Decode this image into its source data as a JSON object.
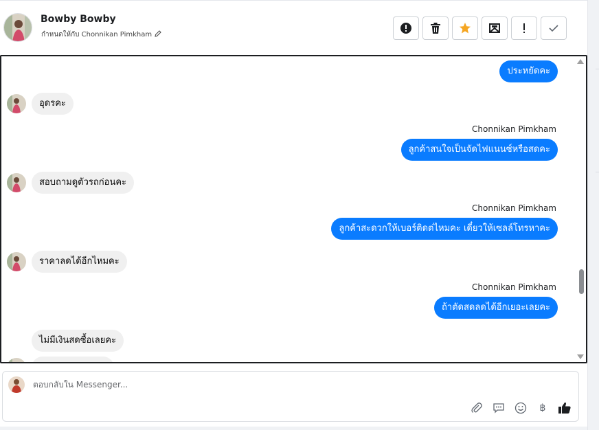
{
  "header": {
    "name": "Bowby Bowby",
    "assigned_text": "กำหนดให้กับ Chonnikan Pimkham",
    "actions": [
      {
        "name": "spam-button",
        "icon": "alert-circle-icon"
      },
      {
        "name": "delete-button",
        "icon": "trash-icon"
      },
      {
        "name": "follow-up-button",
        "icon": "star-icon"
      },
      {
        "name": "mark-unread-button",
        "icon": "envelope-icon"
      },
      {
        "name": "priority-button",
        "icon": "exclamation-icon"
      },
      {
        "name": "done-button",
        "icon": "check-icon"
      }
    ]
  },
  "conversation": {
    "messages": [
      {
        "dir": "out",
        "text": "ประหยัดคะ"
      },
      {
        "dir": "in",
        "text": "อุดรคะ"
      },
      {
        "dir": "out",
        "sender": "Chonnikan Pimkham",
        "text": "ลูกค้าสนใจเป็นจัดไฟแนนซ์หรือสดคะ"
      },
      {
        "dir": "in",
        "text": "สอบถามดูตัวรถก่อนคะ"
      },
      {
        "dir": "out",
        "sender": "Chonnikan Pimkham",
        "text": "ลูกค้าสะดวกให้เบอร์ติดต่ไหมคะ เดี๋ยวให้เซลล์โทรหาคะ"
      },
      {
        "dir": "in",
        "text": "ราคาลดได้อีกไหมคะ"
      },
      {
        "dir": "out",
        "sender": "Chonnikan Pimkham",
        "text": "ถ้าตัดสดลดได้อีกเยอะเลยคะ"
      },
      {
        "dir": "in",
        "text": "ไม่มีเงินสดซื้อเลยคะ"
      }
    ]
  },
  "composer": {
    "placeholder": "ตอบกลับใน Messenger...",
    "icons": [
      "paperclip-icon",
      "saved-reply-icon",
      "emoji-icon",
      "baht-icon",
      "like-icon"
    ],
    "baht_symbol": "฿"
  },
  "colors": {
    "outgoing_bubble": "#0a7cff",
    "incoming_bubble": "#f0f0f0",
    "star": "#f5a623"
  }
}
